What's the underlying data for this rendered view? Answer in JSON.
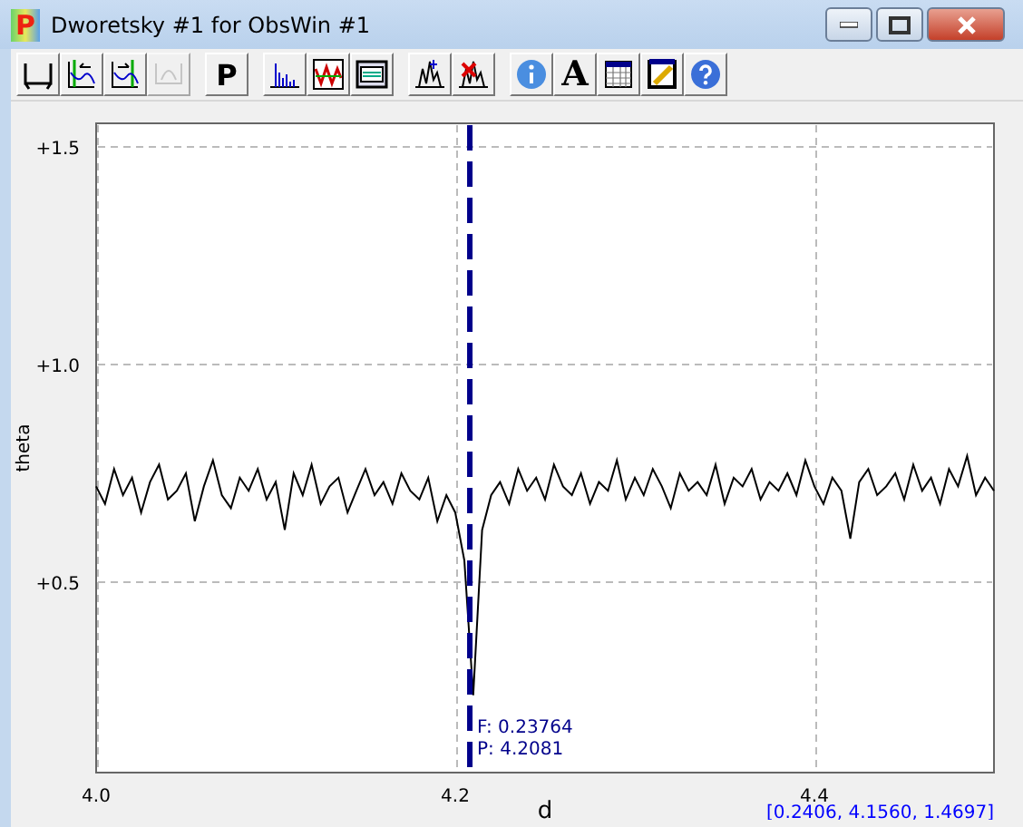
{
  "window": {
    "icon_letter": "P",
    "title": "Dworetsky #1 for ObsWin #1"
  },
  "toolbar": [
    {
      "buttons": [
        {
          "kind": "baseline",
          "disabled": false
        },
        {
          "kind": "left-mark",
          "disabled": false
        },
        {
          "kind": "right-mark",
          "disabled": false
        },
        {
          "kind": "baseline-peak",
          "disabled": true
        }
      ]
    },
    {
      "buttons": [
        {
          "kind": "letter",
          "label": "P",
          "disabled": false
        }
      ]
    },
    {
      "buttons": [
        {
          "kind": "spectrum",
          "disabled": false
        },
        {
          "kind": "wave",
          "disabled": false
        },
        {
          "kind": "window",
          "disabled": false
        }
      ]
    },
    {
      "buttons": [
        {
          "kind": "peak-add",
          "disabled": false
        },
        {
          "kind": "peak-remove",
          "disabled": false
        }
      ]
    },
    {
      "buttons": [
        {
          "kind": "info",
          "disabled": false
        },
        {
          "kind": "letter",
          "label": "A",
          "disabled": false
        },
        {
          "kind": "table",
          "disabled": false
        },
        {
          "kind": "edit",
          "disabled": false
        },
        {
          "kind": "help",
          "disabled": false
        }
      ]
    }
  ],
  "chart_data": {
    "type": "line",
    "xlabel": "d",
    "ylabel": "theta",
    "xlim": [
      4.0,
      4.5
    ],
    "ylim": [
      0.0625,
      1.554
    ],
    "xticks": [
      {
        "value": 4.0,
        "label": "4.0"
      },
      {
        "value": 4.2,
        "label": "4.2"
      },
      {
        "value": 4.4,
        "label": "4.4"
      }
    ],
    "yticks": [
      {
        "value": 0.5,
        "label": "+0.5"
      },
      {
        "value": 1.0,
        "label": "+1.0"
      },
      {
        "value": 1.5,
        "label": "+1.5"
      }
    ],
    "x": [
      4.0,
      4.005,
      4.01,
      4.015,
      4.02,
      4.025,
      4.03,
      4.035,
      4.04,
      4.045,
      4.05,
      4.055,
      4.06,
      4.065,
      4.07,
      4.075,
      4.08,
      4.085,
      4.09,
      4.095,
      4.1,
      4.105,
      4.11,
      4.115,
      4.12,
      4.125,
      4.13,
      4.135,
      4.14,
      4.145,
      4.15,
      4.155,
      4.16,
      4.165,
      4.17,
      4.175,
      4.18,
      4.185,
      4.19,
      4.195,
      4.2,
      4.205,
      4.21,
      4.215,
      4.22,
      4.225,
      4.23,
      4.235,
      4.24,
      4.245,
      4.25,
      4.255,
      4.26,
      4.265,
      4.27,
      4.275,
      4.28,
      4.285,
      4.29,
      4.295,
      4.3,
      4.305,
      4.31,
      4.315,
      4.32,
      4.325,
      4.33,
      4.335,
      4.34,
      4.345,
      4.35,
      4.355,
      4.36,
      4.365,
      4.37,
      4.375,
      4.38,
      4.385,
      4.39,
      4.395,
      4.4,
      4.405,
      4.41,
      4.415,
      4.42,
      4.425,
      4.43,
      4.435,
      4.44,
      4.445,
      4.45,
      4.455,
      4.46,
      4.465,
      4.47,
      4.475,
      4.48,
      4.485,
      4.49,
      4.495,
      4.5
    ],
    "series": [
      {
        "color": "#000000",
        "values": [
          0.72,
          0.68,
          0.76,
          0.7,
          0.74,
          0.66,
          0.73,
          0.77,
          0.69,
          0.71,
          0.75,
          0.64,
          0.72,
          0.78,
          0.7,
          0.67,
          0.74,
          0.71,
          0.76,
          0.69,
          0.73,
          0.62,
          0.75,
          0.7,
          0.77,
          0.68,
          0.72,
          0.74,
          0.66,
          0.71,
          0.76,
          0.7,
          0.73,
          0.68,
          0.75,
          0.71,
          0.69,
          0.74,
          0.64,
          0.7,
          0.66,
          0.55,
          0.24,
          0.62,
          0.7,
          0.73,
          0.68,
          0.76,
          0.71,
          0.74,
          0.69,
          0.77,
          0.72,
          0.7,
          0.75,
          0.68,
          0.73,
          0.71,
          0.78,
          0.69,
          0.74,
          0.7,
          0.76,
          0.72,
          0.67,
          0.75,
          0.71,
          0.73,
          0.7,
          0.77,
          0.68,
          0.74,
          0.72,
          0.76,
          0.69,
          0.73,
          0.71,
          0.75,
          0.7,
          0.78,
          0.72,
          0.68,
          0.74,
          0.71,
          0.6,
          0.73,
          0.76,
          0.7,
          0.72,
          0.75,
          0.69,
          0.77,
          0.71,
          0.74,
          0.68,
          0.76,
          0.72,
          0.79,
          0.7,
          0.74,
          0.71
        ]
      }
    ],
    "grid": true,
    "ref_lines": [
      {
        "axis": "x",
        "value": 4.2081
      }
    ],
    "annotations": [
      "F: 0.23764",
      "P: 4.2081"
    ]
  },
  "cursor_readout": "[0.2406, 4.1560, 1.4697]"
}
